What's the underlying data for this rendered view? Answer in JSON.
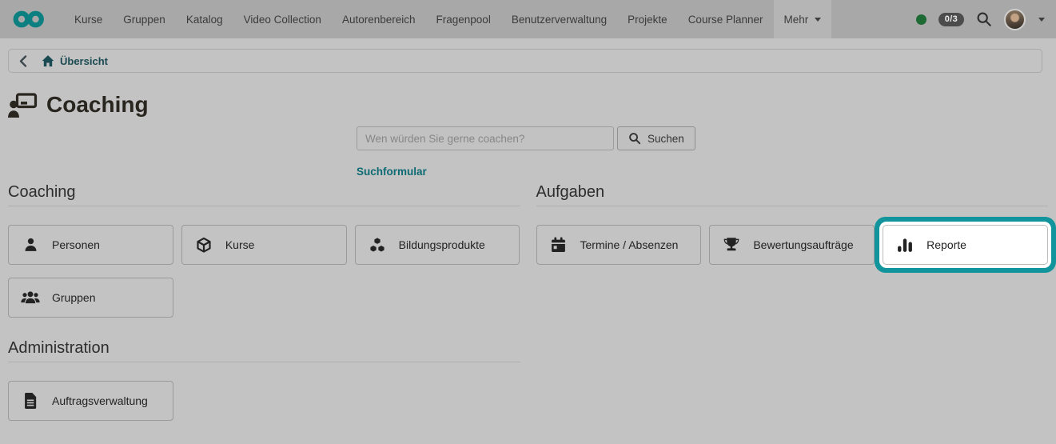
{
  "topnav": {
    "items": [
      {
        "label": "Kurse"
      },
      {
        "label": "Gruppen"
      },
      {
        "label": "Katalog"
      },
      {
        "label": "Video Collection"
      },
      {
        "label": "Autorenbereich"
      },
      {
        "label": "Fragenpool"
      },
      {
        "label": "Benutzerverwaltung"
      },
      {
        "label": "Projekte"
      },
      {
        "label": "Course Planner"
      },
      {
        "label": "Mehr"
      }
    ],
    "logo": "infinity-logo",
    "status_badge": "0/3",
    "icons": [
      "presence-dot",
      "search-icon",
      "avatar",
      "caret-down-icon"
    ]
  },
  "breadcrumb": {
    "home_label": "Übersicht"
  },
  "page": {
    "title": "Coaching",
    "title_icon": "coaching-presenter-icon"
  },
  "search": {
    "placeholder": "Wen würden Sie gerne coachen?",
    "button_label": "Suchen",
    "link_label": "Suchformular"
  },
  "sections": {
    "coaching": {
      "title": "Coaching",
      "buttons": [
        {
          "label": "Personen",
          "icon": "person-icon"
        },
        {
          "label": "Kurse",
          "icon": "cube-icon"
        },
        {
          "label": "Bildungsprodukte",
          "icon": "cubes-icon"
        },
        {
          "label": "Gruppen",
          "icon": "users-icon"
        }
      ]
    },
    "aufgaben": {
      "title": "Aufgaben",
      "buttons": [
        {
          "label": "Termine / Absenzen",
          "icon": "calendar-icon"
        },
        {
          "label": "Bewertungsaufträge",
          "icon": "trophy-icon"
        },
        {
          "label": "Reporte",
          "icon": "bar-chart-icon",
          "highlighted": true
        }
      ]
    },
    "administration": {
      "title": "Administration",
      "buttons": [
        {
          "label": "Auftragsverwaltung",
          "icon": "document-icon"
        }
      ]
    }
  },
  "colors": {
    "accent_teal": "#0c7f80",
    "highlight_ring": "#11949c",
    "link_teal": "#0e6b73",
    "breadcrumb_teal": "#1a4a52",
    "presence_green": "#1d6a35",
    "topbar_bg": "#a8a8a8",
    "page_bg": "#c3c3c3"
  }
}
